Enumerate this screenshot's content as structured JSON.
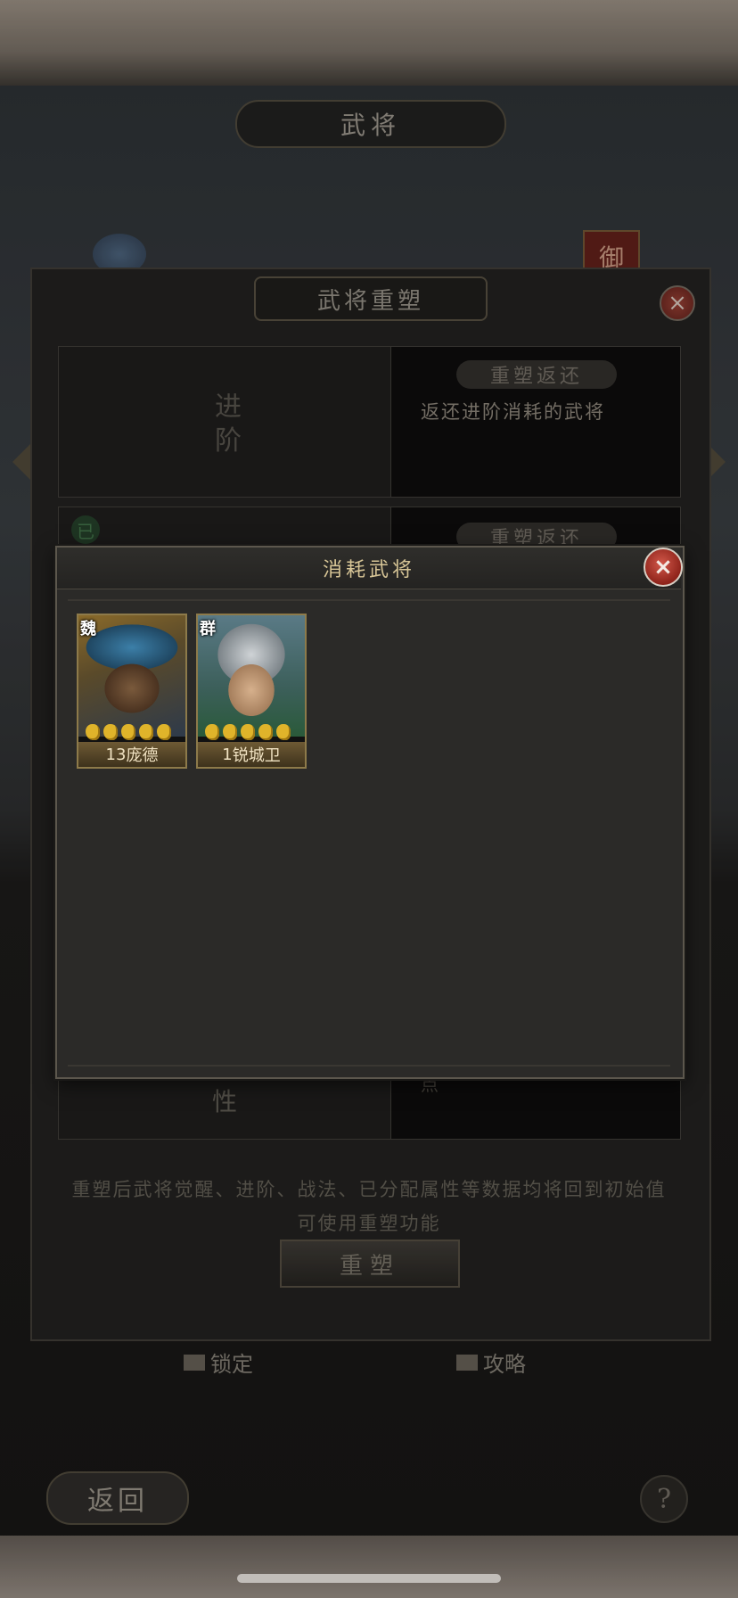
{
  "base_screen": {
    "title": "武将",
    "faction_badge_text": "御"
  },
  "reset_dialog": {
    "title": "武将重塑",
    "close_icon": "×",
    "advance_label": "进阶",
    "return_tag": "重塑返还",
    "return_desc": "返还进阶消耗的武将",
    "return_tag_2": "重塑返还",
    "awakened_label": "已",
    "attribute_label": "性",
    "point_label": "点",
    "description_line1": "重塑后武将觉醒、进阶、战法、已分配属性等数据均将回到初始值",
    "description_line2": "可使用重塑功能",
    "reset_button": "重塑"
  },
  "footer": {
    "lock_label": "锁定",
    "guide_label": "攻略",
    "back_button": "返回",
    "help_button": "?"
  },
  "popup": {
    "title": "消耗武将",
    "close_icon": "×",
    "cards": [
      {
        "faction": "魏",
        "level": "13",
        "name": "庞德",
        "stars": 5
      },
      {
        "faction": "群",
        "level": "1",
        "name": "锐城卫",
        "stars": 5
      }
    ]
  },
  "colors": {
    "accent_gold": "#d7c596",
    "close_red": "#b0372b",
    "star_gold": "#e0b42a"
  }
}
